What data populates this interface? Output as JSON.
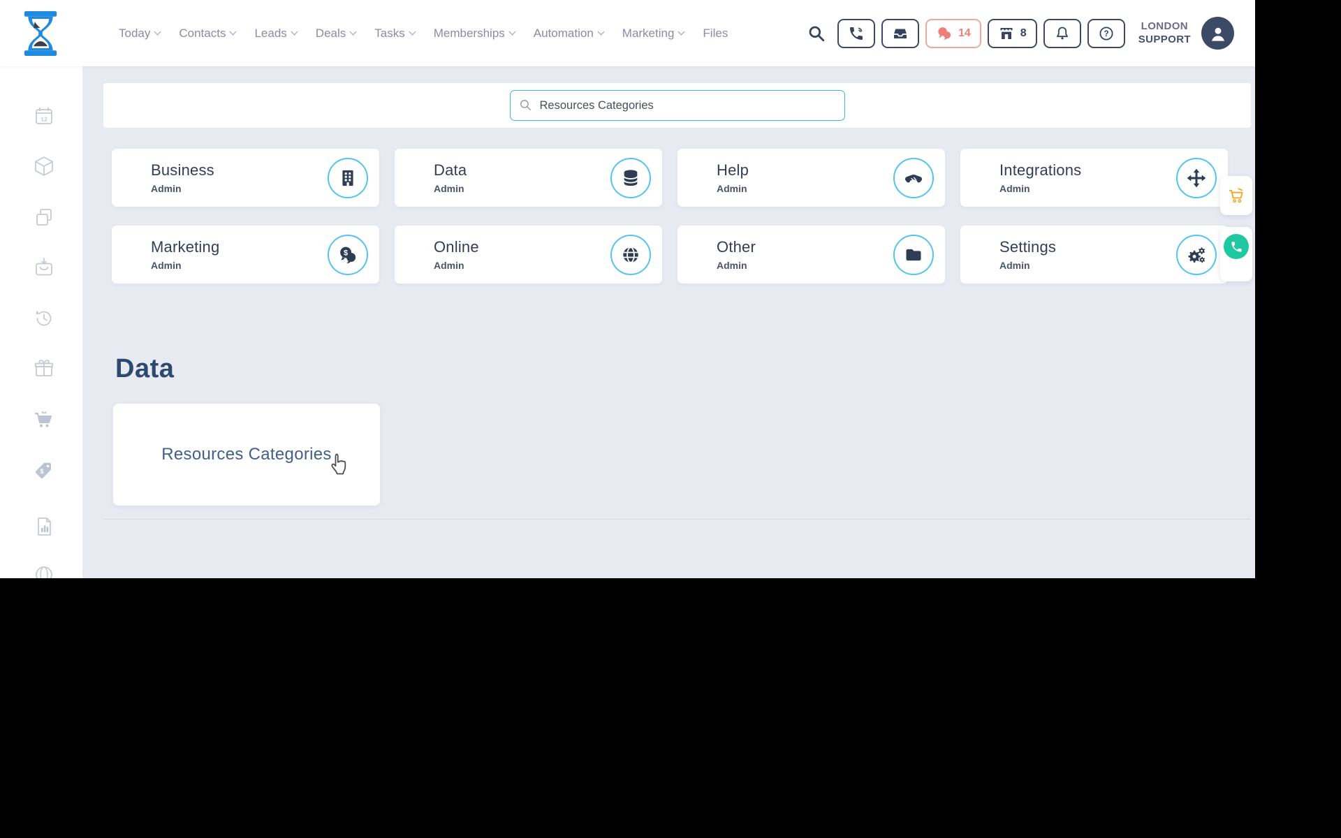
{
  "topbar": {
    "nav": [
      {
        "label": "Today"
      },
      {
        "label": "Contacts"
      },
      {
        "label": "Leads"
      },
      {
        "label": "Deals"
      },
      {
        "label": "Tasks"
      },
      {
        "label": "Memberships"
      },
      {
        "label": "Automation"
      },
      {
        "label": "Marketing"
      },
      {
        "label": "Files"
      }
    ],
    "chat_badge": "14",
    "store_badge": "8",
    "account_line1": "LONDON",
    "account_line2": "SUPPORT"
  },
  "search": {
    "value": "Resources Categories"
  },
  "cards": [
    {
      "title": "Business",
      "subtitle": "Admin",
      "icon": "building-icon"
    },
    {
      "title": "Data",
      "subtitle": "Admin",
      "icon": "database-icon"
    },
    {
      "title": "Help",
      "subtitle": "Admin",
      "icon": "handshake-icon"
    },
    {
      "title": "Integrations",
      "subtitle": "Admin",
      "icon": "move-arrows-icon"
    },
    {
      "title": "Marketing",
      "subtitle": "Admin",
      "icon": "money-chat-icon"
    },
    {
      "title": "Online",
      "subtitle": "Admin",
      "icon": "globe-icon"
    },
    {
      "title": "Other",
      "subtitle": "Admin",
      "icon": "folder-icon"
    },
    {
      "title": "Settings",
      "subtitle": "Admin",
      "icon": "gears-icon"
    }
  ],
  "section": {
    "heading": "Data",
    "items": [
      {
        "label": "Resources Categories"
      }
    ]
  },
  "icons": {
    "help_glyph": "?",
    "calendar_day": "12",
    "dollar": "$"
  },
  "colors": {
    "brand_blue": "#1f8ade",
    "accent_blue": "#55c3f2",
    "navy": "#36425f",
    "salmon": "#ee7f76",
    "orange": "#f5a623",
    "green": "#1fc8a0",
    "main_bg": "#e8eaf2"
  }
}
